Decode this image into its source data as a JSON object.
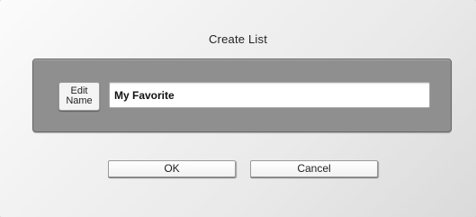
{
  "dialog": {
    "title": "Create List",
    "edit_name_line1": "Edit",
    "edit_name_line2": "Name",
    "name_value": "My Favorite",
    "ok_label": "OK",
    "cancel_label": "Cancel"
  }
}
